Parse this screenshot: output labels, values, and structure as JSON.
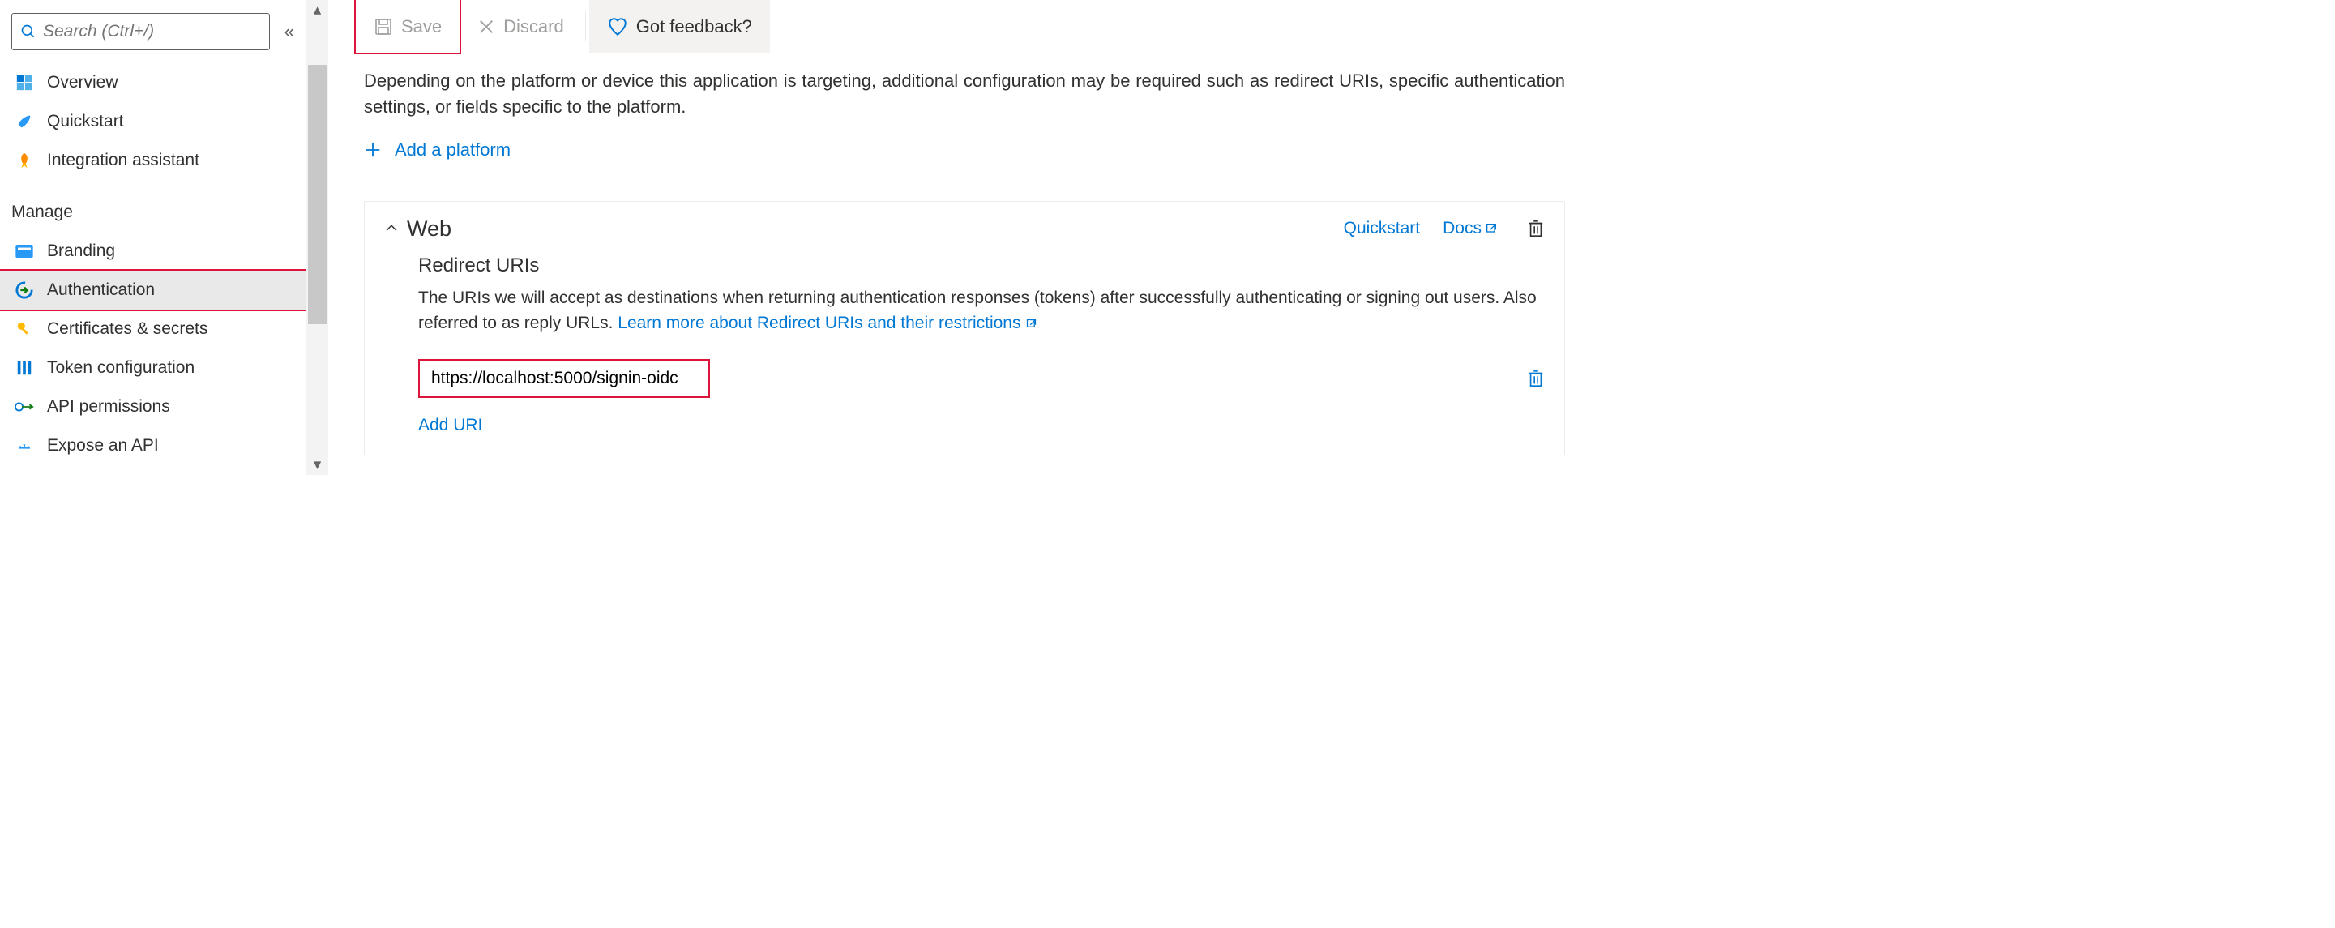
{
  "sidebar": {
    "search_placeholder": "Search (Ctrl+/)",
    "items_top": [
      {
        "label": "Overview"
      },
      {
        "label": "Quickstart"
      },
      {
        "label": "Integration assistant"
      }
    ],
    "section_label": "Manage",
    "items_manage": [
      {
        "label": "Branding"
      },
      {
        "label": "Authentication",
        "active": true
      },
      {
        "label": "Certificates & secrets"
      },
      {
        "label": "Token configuration"
      },
      {
        "label": "API permissions"
      },
      {
        "label": "Expose an API"
      }
    ]
  },
  "toolbar": {
    "save_label": "Save",
    "discard_label": "Discard",
    "feedback_label": "Got feedback?"
  },
  "main": {
    "intro_text": "Depending on the platform or device this application is targeting, additional configuration may be required such as redirect URIs, specific authentication settings, or fields specific to the platform.",
    "add_platform_label": "Add a platform",
    "card": {
      "title": "Web",
      "quickstart_label": "Quickstart",
      "docs_label": "Docs",
      "redirect_title": "Redirect URIs",
      "redirect_desc": "The URIs we will accept as destinations when returning authentication responses (tokens) after successfully authenticating or signing out users. Also referred to as reply URLs. ",
      "learn_more_label": "Learn more about Redirect URIs and their restrictions",
      "uri_value": "https://localhost:5000/signin-oidc",
      "add_uri_label": "Add URI"
    }
  }
}
